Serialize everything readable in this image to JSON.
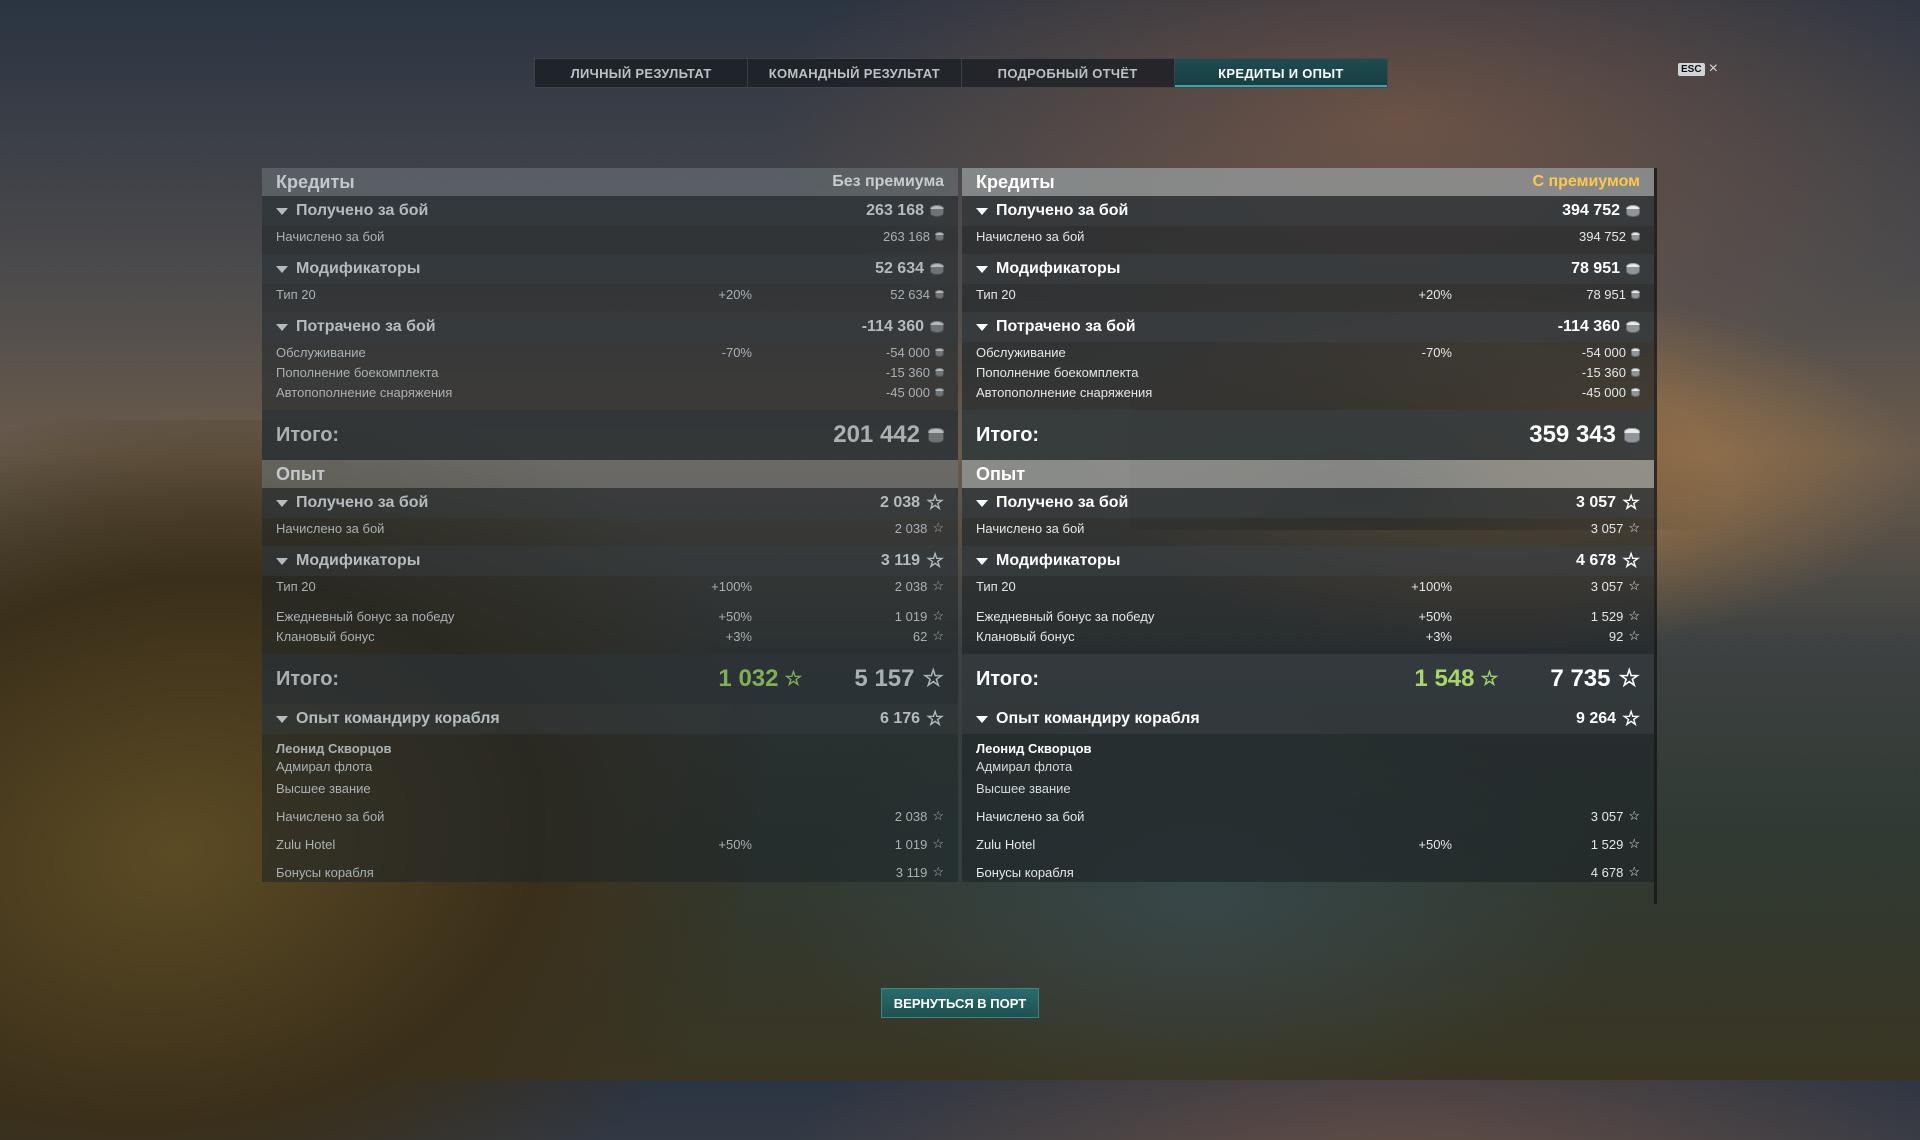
{
  "tabs": [
    "ЛИЧНЫЙ РЕЗУЛЬТАТ",
    "КОМАНДНЫЙ РЕЗУЛЬТАТ",
    "ПОДРОБНЫЙ ОТЧЁТ",
    "КРЕДИТЫ И ОПЫТ"
  ],
  "active_tab": "КРЕДИТЫ И ОПЫТ",
  "esc": {
    "key": "ESC",
    "close": "×"
  },
  "return_button": "ВЕРНУТЬСЯ В ПОРТ",
  "left": {
    "credits": {
      "title": "Кредиты",
      "subtitle": "Без премиума",
      "earned": {
        "label": "Получено за бой",
        "value": "263 168",
        "items": [
          {
            "label": "Начислено за бой",
            "value": "263 168"
          }
        ]
      },
      "mods": {
        "label": "Модификаторы",
        "value": "52 634",
        "items": [
          {
            "label": "Тип 20",
            "pct": "+20%",
            "value": "52 634"
          }
        ]
      },
      "spent": {
        "label": "Потрачено за бой",
        "value": "-114 360",
        "items": [
          {
            "label": "Обслуживание",
            "pct": "-70%",
            "value": "-54 000"
          },
          {
            "label": "Пополнение боекомплекта",
            "value": "-15 360"
          },
          {
            "label": "Автопополнение снаряжения",
            "value": "-45 000"
          }
        ]
      },
      "total_label": "Итого:",
      "total": "201 442"
    },
    "xp": {
      "title": "Опыт",
      "earned": {
        "label": "Получено за бой",
        "value": "2 038",
        "items": [
          {
            "label": "Начислено за бой",
            "value": "2 038"
          }
        ]
      },
      "mods": {
        "label": "Модификаторы",
        "value": "3 119",
        "items": [
          {
            "label": "Тип 20",
            "pct": "+100%",
            "value": "2 038"
          },
          {
            "label": "Ежедневный бонус за победу",
            "pct": "+50%",
            "value": "1 019"
          },
          {
            "label": "Клановый бонус",
            "pct": "+3%",
            "value": "62"
          }
        ]
      },
      "total_label": "Итого:",
      "total_free": "1 032",
      "total": "5 157",
      "commander": {
        "label": "Опыт командиру корабля",
        "value": "6 176",
        "name": "Леонид Скворцов",
        "rank": "Адмирал флота",
        "rank2": "Высшее звание",
        "items": [
          {
            "label": "Начислено за бой",
            "value": "2 038"
          },
          {
            "label": "Zulu Hotel",
            "pct": "+50%",
            "value": "1 019"
          },
          {
            "label": "Бонусы корабля",
            "value": "3 119"
          }
        ]
      }
    }
  },
  "right": {
    "credits": {
      "title": "Кредиты",
      "subtitle": "С премиумом",
      "earned": {
        "label": "Получено за бой",
        "value": "394 752",
        "items": [
          {
            "label": "Начислено за бой",
            "value": "394 752"
          }
        ]
      },
      "mods": {
        "label": "Модификаторы",
        "value": "78 951",
        "items": [
          {
            "label": "Тип 20",
            "pct": "+20%",
            "value": "78 951"
          }
        ]
      },
      "spent": {
        "label": "Потрачено за бой",
        "value": "-114 360",
        "items": [
          {
            "label": "Обслуживание",
            "pct": "-70%",
            "value": "-54 000"
          },
          {
            "label": "Пополнение боекомплекта",
            "value": "-15 360"
          },
          {
            "label": "Автопополнение снаряжения",
            "value": "-45 000"
          }
        ]
      },
      "total_label": "Итого:",
      "total": "359 343"
    },
    "xp": {
      "title": "Опыт",
      "earned": {
        "label": "Получено за бой",
        "value": "3 057",
        "items": [
          {
            "label": "Начислено за бой",
            "value": "3 057"
          }
        ]
      },
      "mods": {
        "label": "Модификаторы",
        "value": "4 678",
        "items": [
          {
            "label": "Тип 20",
            "pct": "+100%",
            "value": "3 057"
          },
          {
            "label": "Ежедневный бонус за победу",
            "pct": "+50%",
            "value": "1 529"
          },
          {
            "label": "Клановый бонус",
            "pct": "+3%",
            "value": "92"
          }
        ]
      },
      "total_label": "Итого:",
      "total_free": "1 548",
      "total": "7 735",
      "commander": {
        "label": "Опыт командиру корабля",
        "value": "9 264",
        "name": "Леонид Скворцов",
        "rank": "Адмирал флота",
        "rank2": "Высшее звание",
        "items": [
          {
            "label": "Начислено за бой",
            "value": "3 057"
          },
          {
            "label": "Zulu Hotel",
            "pct": "+50%",
            "value": "1 529"
          },
          {
            "label": "Бонусы корабля",
            "value": "4 678"
          }
        ]
      }
    }
  },
  "colors": {
    "accent": "#3fa3a5",
    "premium": "#ffc84a",
    "free_xp": "#a6d66c"
  },
  "icons": {
    "credits": "coin-icon",
    "xp": "star-icon",
    "expand": "triangle-down-icon",
    "close": "close-icon"
  }
}
